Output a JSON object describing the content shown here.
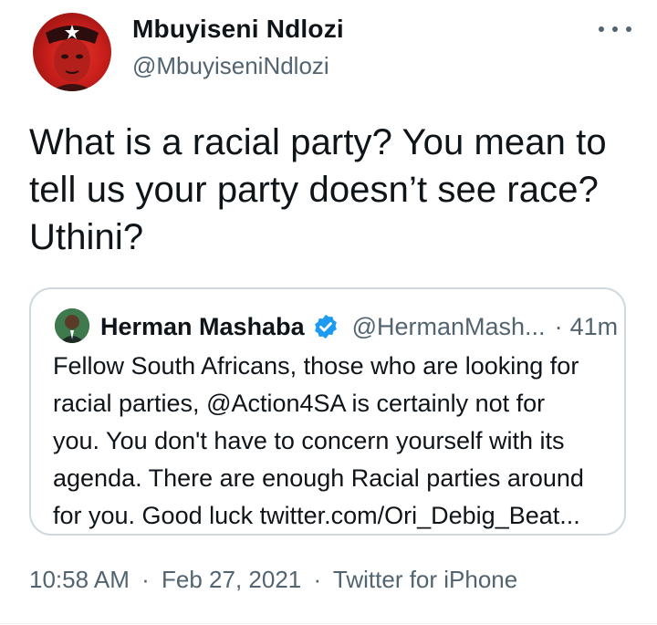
{
  "author": {
    "name": "Mbuyiseni Ndlozi",
    "handle": "@MbuyiseniNdlozi",
    "avatar_icon": "profile-avatar"
  },
  "tweet": {
    "line1": "What is a racial party? You mean to",
    "line2": "tell us your party doesn’t see race?",
    "line3": "Uthini?"
  },
  "quoted_tweet": {
    "name": "Herman Mashaba",
    "verified_icon": "verified-badge-icon",
    "handle": "@HermanMash...",
    "separator": "·",
    "time": "41m",
    "line1": "Fellow South Africans, those who are looking for",
    "line2": "racial parties, @Action4SA is certainly not for",
    "line3": "you. You don't have to concern yourself with its",
    "line4": "agenda. There are enough Racial parties around",
    "line5": "for you. Good luck twitter.com/Ori_Debig_Beat..."
  },
  "meta": {
    "time": "10:58 AM",
    "separator": "·",
    "date": "Feb 27, 2021",
    "source": "Twitter for iPhone"
  },
  "colors": {
    "text": "#0f1419",
    "secondary": "#536471",
    "border": "#cfd9de",
    "verified": "#1d9bf0"
  }
}
